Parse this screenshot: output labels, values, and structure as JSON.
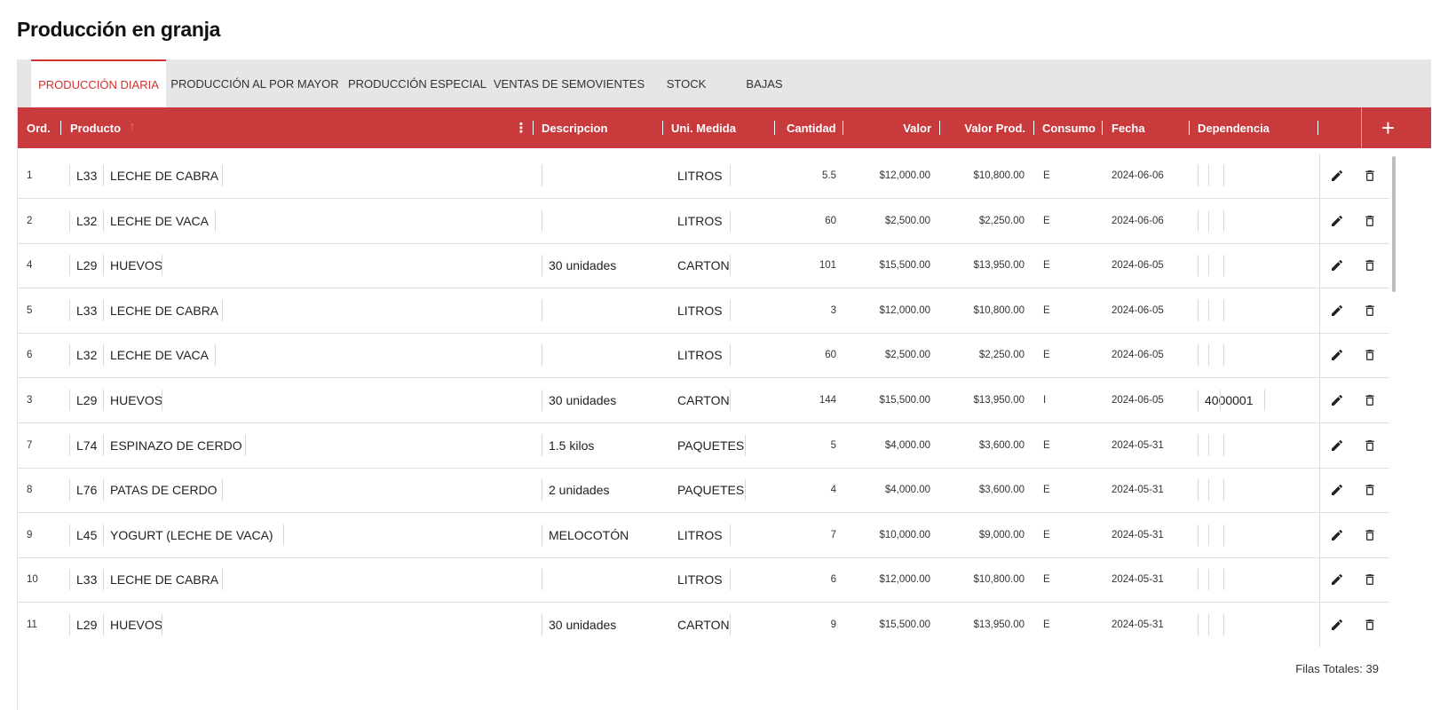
{
  "page": {
    "title": "Producción en granja"
  },
  "tabs": [
    {
      "label": "PRODUCCIÓN DIARIA",
      "active": true
    },
    {
      "label": "PRODUCCIÓN AL POR MAYOR",
      "active": false
    },
    {
      "label": "PRODUCCIÓN ESPECIAL",
      "active": false
    },
    {
      "label": "VENTAS DE SEMOVIENTES",
      "active": false
    },
    {
      "label": "STOCK",
      "active": false
    },
    {
      "label": "BAJAS",
      "active": false
    }
  ],
  "grid": {
    "columns": {
      "ord": "Ord.",
      "producto": "Producto",
      "descripcion": "Descripcion",
      "unidad": "Uni. Medida",
      "cantidad": "Cantidad",
      "valor": "Valor",
      "valor_prod": "Valor Prod.",
      "consumo": "Consumo",
      "fecha": "Fecha",
      "dependencia": "Dependencia"
    },
    "add_icon": "+",
    "sort_icon": "↑",
    "column_menu_icon": "⋮",
    "rows": [
      {
        "ord": "1",
        "code": "L33",
        "producto": "LECHE DE CABRA",
        "descripcion": "",
        "unidad": "LITROS",
        "cantidad": "5.5",
        "valor": "$12,000.00",
        "valor_prod": "$10,800.00",
        "consumo": "E",
        "fecha": "2024-06-06",
        "dependencia": ""
      },
      {
        "ord": "2",
        "code": "L32",
        "producto": "LECHE DE VACA",
        "descripcion": "",
        "unidad": "LITROS",
        "cantidad": "60",
        "valor": "$2,500.00",
        "valor_prod": "$2,250.00",
        "consumo": "E",
        "fecha": "2024-06-06",
        "dependencia": ""
      },
      {
        "ord": "4",
        "code": "L29",
        "producto": "HUEVOS",
        "descripcion": "30 unidades",
        "unidad": "CARTON",
        "cantidad": "101",
        "valor": "$15,500.00",
        "valor_prod": "$13,950.00",
        "consumo": "E",
        "fecha": "2024-06-05",
        "dependencia": ""
      },
      {
        "ord": "5",
        "code": "L33",
        "producto": "LECHE DE CABRA",
        "descripcion": "",
        "unidad": "LITROS",
        "cantidad": "3",
        "valor": "$12,000.00",
        "valor_prod": "$10,800.00",
        "consumo": "E",
        "fecha": "2024-06-05",
        "dependencia": ""
      },
      {
        "ord": "6",
        "code": "L32",
        "producto": "LECHE DE VACA",
        "descripcion": "",
        "unidad": "LITROS",
        "cantidad": "60",
        "valor": "$2,500.00",
        "valor_prod": "$2,250.00",
        "consumo": "E",
        "fecha": "2024-06-05",
        "dependencia": ""
      },
      {
        "ord": "3",
        "code": "L29",
        "producto": "HUEVOS",
        "descripcion": "30 unidades",
        "unidad": "CARTON",
        "cantidad": "144",
        "valor": "$15,500.00",
        "valor_prod": "$13,950.00",
        "consumo": "I",
        "fecha": "2024-06-05",
        "dependencia": "4000001"
      },
      {
        "ord": "7",
        "code": "L74",
        "producto": "ESPINAZO DE CERDO",
        "descripcion": "1.5 kilos",
        "unidad": "PAQUETES",
        "cantidad": "5",
        "valor": "$4,000.00",
        "valor_prod": "$3,600.00",
        "consumo": "E",
        "fecha": "2024-05-31",
        "dependencia": ""
      },
      {
        "ord": "8",
        "code": "L76",
        "producto": "PATAS DE CERDO",
        "descripcion": "2 unidades",
        "unidad": "PAQUETES",
        "cantidad": "4",
        "valor": "$4,000.00",
        "valor_prod": "$3,600.00",
        "consumo": "E",
        "fecha": "2024-05-31",
        "dependencia": ""
      },
      {
        "ord": "9",
        "code": "L45",
        "producto": "YOGURT (LECHE DE VACA)",
        "descripcion": "MELOCOTÓN",
        "unidad": "LITROS",
        "cantidad": "7",
        "valor": "$10,000.00",
        "valor_prod": "$9,000.00",
        "consumo": "E",
        "fecha": "2024-05-31",
        "dependencia": ""
      },
      {
        "ord": "10",
        "code": "L33",
        "producto": "LECHE DE CABRA",
        "descripcion": "",
        "unidad": "LITROS",
        "cantidad": "6",
        "valor": "$12,000.00",
        "valor_prod": "$10,800.00",
        "consumo": "E",
        "fecha": "2024-05-31",
        "dependencia": ""
      },
      {
        "ord": "11",
        "code": "L29",
        "producto": "HUEVOS",
        "descripcion": "30 unidades",
        "unidad": "CARTON",
        "cantidad": "9",
        "valor": "$15,500.00",
        "valor_prod": "$13,950.00",
        "consumo": "E",
        "fecha": "2024-05-31",
        "dependencia": ""
      }
    ],
    "footer": {
      "total_label": "Filas Totales: 39"
    }
  },
  "colors": {
    "accent": "#c93a3c",
    "active_tab_text": "#d32f2f",
    "tabbar_bg": "#e6e6e6"
  }
}
